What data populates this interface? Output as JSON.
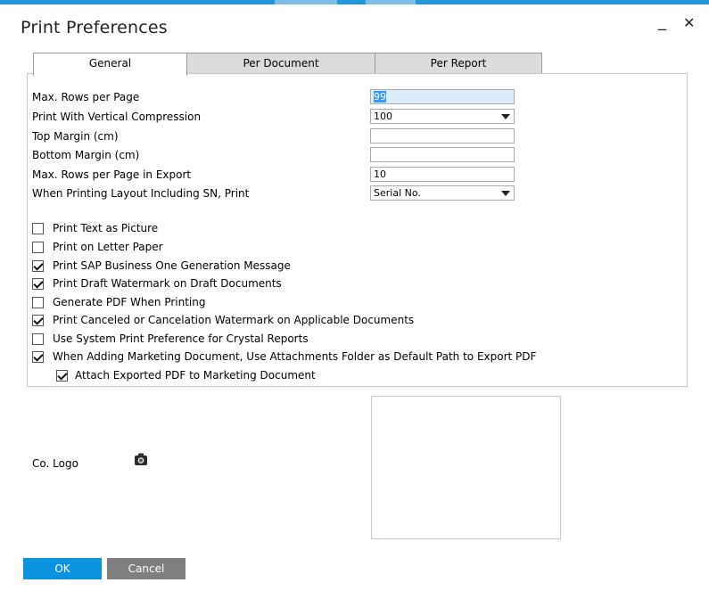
{
  "window": {
    "title": "Print Preferences",
    "minimize_symbol": "_",
    "close_symbol": "✕"
  },
  "tabs": [
    {
      "label": "General",
      "active": true
    },
    {
      "label": "Per Document",
      "active": false
    },
    {
      "label": "Per Report",
      "active": false
    }
  ],
  "fields": [
    {
      "label": "Max. Rows per Page",
      "value": "99",
      "type": "text"
    },
    {
      "label": "Print With Vertical Compression",
      "value": "100",
      "type": "select"
    },
    {
      "label": "Top Margin (cm)",
      "value": "",
      "type": "text"
    },
    {
      "label": "Bottom Margin (cm)",
      "value": "",
      "type": "text"
    },
    {
      "label": "Max. Rows per Page in Export",
      "value": "10",
      "type": "text"
    },
    {
      "label": "When Printing Layout Including SN, Print",
      "value": "Serial No.",
      "type": "select"
    }
  ],
  "checkboxes": [
    {
      "label": "Print Text as Picture",
      "checked": false
    },
    {
      "label": "Print on Letter Paper",
      "checked": false
    },
    {
      "label": "Print SAP Business One Generation Message",
      "checked": true
    },
    {
      "label": "Print Draft Watermark on Draft Documents",
      "checked": true
    },
    {
      "label": "Generate PDF When Printing",
      "checked": false
    },
    {
      "label": "Print Canceled or Cancelation Watermark on Applicable Documents",
      "checked": true
    },
    {
      "label": "Use System Print Preference for Crystal Reports",
      "checked": false
    },
    {
      "label": "When Adding Marketing Document, Use Attachments Folder as Default Path to Export PDF",
      "checked": true
    },
    {
      "label": "Attach Exported PDF to Marketing Document",
      "checked": true
    }
  ],
  "logo": {
    "label": "Co. Logo",
    "icon": "camera-icon"
  },
  "buttons": {
    "ok": "OK",
    "cancel": "Cancel"
  },
  "colors": {
    "accent": "#0b93e0",
    "cancel": "#7f7f7f",
    "selection": "#3399ff"
  }
}
